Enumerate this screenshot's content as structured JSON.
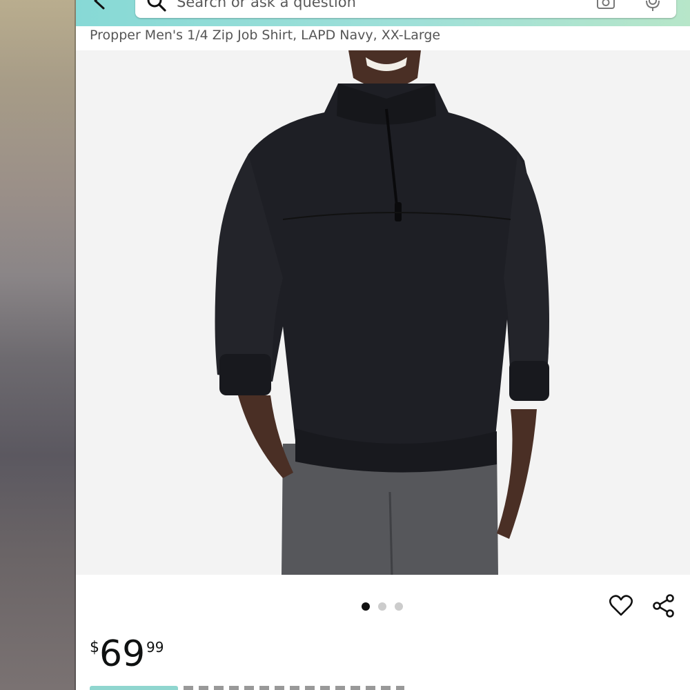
{
  "search": {
    "placeholder": "Search or ask a question"
  },
  "product": {
    "title": "Propper Men's 1/4 Zip Job Shirt, LAPD Navy, XX-Large",
    "image_alt": "Man wearing a dark navy quarter-zip job shirt with grey pants"
  },
  "gallery": {
    "image_count": 3,
    "active_index": 0
  },
  "price": {
    "symbol": "$",
    "whole": "69",
    "fraction": "99"
  },
  "icons": {
    "back": "back-arrow-icon",
    "search": "search-icon",
    "camera": "camera-icon",
    "mic": "mic-icon",
    "wishlist": "heart-icon",
    "share": "share-icon"
  },
  "colors": {
    "header_start": "#87d9d6",
    "header_end": "#b7e6c9",
    "text_primary": "#0f1111",
    "text_secondary": "#555555",
    "dot_active": "#111111",
    "dot_inactive": "#cccccc"
  }
}
